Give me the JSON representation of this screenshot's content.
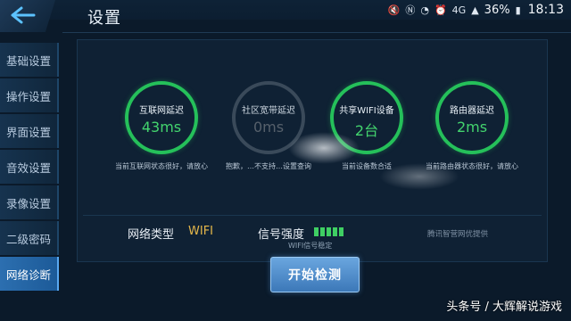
{
  "status_bar": {
    "battery": "36%",
    "time": "18:13",
    "icons": [
      "mute-icon",
      "nfc-icon",
      "wifi-icon",
      "alarm-icon",
      "4g-icon",
      "signal-icon",
      "battery-icon"
    ]
  },
  "header": {
    "title": "设置",
    "back_icon": "back-arrow-icon"
  },
  "sidebar": {
    "items": [
      {
        "label": "基础设置",
        "active": false
      },
      {
        "label": "操作设置",
        "active": false
      },
      {
        "label": "界面设置",
        "active": false
      },
      {
        "label": "音效设置",
        "active": false
      },
      {
        "label": "录像设置",
        "active": false
      },
      {
        "label": "二级密码",
        "active": false
      },
      {
        "label": "网络诊断",
        "active": true
      }
    ]
  },
  "gauges": [
    {
      "label": "互联网延迟",
      "value": "43ms",
      "desc": "当前互联网状态很好，请放心",
      "enabled": true
    },
    {
      "label": "社区宽带延迟",
      "value": "0ms",
      "desc": "抱歉，…不支持…设置查询",
      "enabled": false
    },
    {
      "label": "共享WIFI设备",
      "value": "2台",
      "desc": "当前设备数合适",
      "enabled": true
    },
    {
      "label": "路由器延迟",
      "value": "2ms",
      "desc": "当前路由器状态很好，请放心",
      "enabled": true
    }
  ],
  "info": {
    "net_type_label": "网络类型",
    "net_type_value": "WIFI",
    "signal_label": "信号强度",
    "signal_bars": 5,
    "signal_desc": "WIFI信号稳定",
    "provider": "腾讯智营网优提供"
  },
  "start_button": "开始检测",
  "watermark": "头条号 / 大辉解说游戏",
  "colors": {
    "accent_green": "#25c05a",
    "accent_blue": "#3c78b8",
    "wifi_gold": "#e6b84a"
  }
}
